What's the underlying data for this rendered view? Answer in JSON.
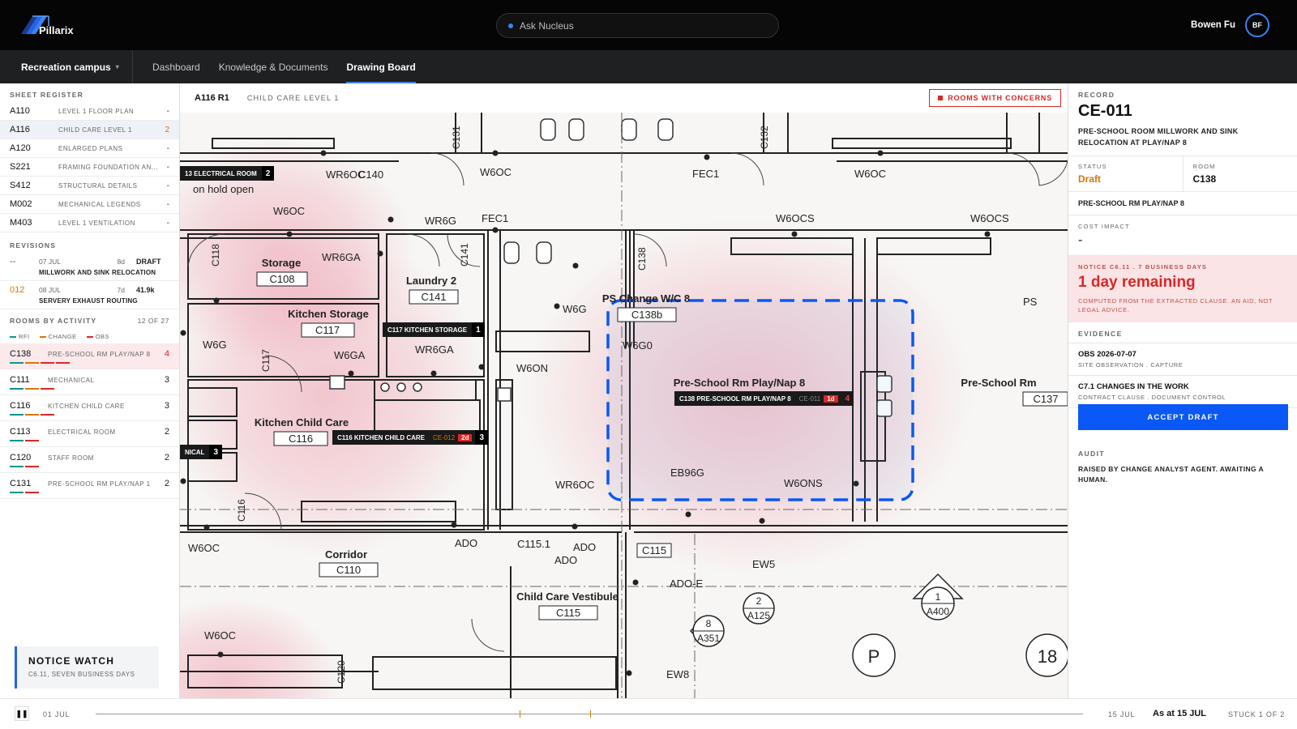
{
  "app": {
    "brand": "Pillarix",
    "search_placeholder": "Ask Nucleus",
    "user_name": "Bowen Fu",
    "user_initials": "BF"
  },
  "nav": {
    "campus": "Recreation campus",
    "tabs": [
      {
        "label": "Dashboard"
      },
      {
        "label": "Knowledge & Documents"
      },
      {
        "label": "Drawing Board"
      }
    ],
    "active_tab": "Drawing Board"
  },
  "sheet_register": {
    "title": "SHEET REGISTER",
    "items": [
      {
        "id": "A110",
        "name": "LEVEL 1 FLOOR PLAN",
        "count": "-"
      },
      {
        "id": "A116",
        "name": "CHILD CARE LEVEL 1",
        "count": "2",
        "active": true
      },
      {
        "id": "A120",
        "name": "ENLARGED PLANS",
        "count": "-"
      },
      {
        "id": "S221",
        "name": "FRAMING FOUNDATION AN...",
        "count": "-"
      },
      {
        "id": "S412",
        "name": "STRUCTURAL DETAILS",
        "count": "-"
      },
      {
        "id": "M002",
        "name": "MECHANICAL LEGENDS",
        "count": "-"
      },
      {
        "id": "M403",
        "name": "LEVEL 1 VENTILATION",
        "count": "-"
      }
    ]
  },
  "revisions": {
    "title": "REVISIONS",
    "items": [
      {
        "id": "--",
        "date": "07 JUL",
        "age": "8d",
        "tag": "DRAFT",
        "desc": "MILLWORK AND SINK RELOCATION"
      },
      {
        "id": "012",
        "date": "08 JUL",
        "age": "7d",
        "tag": "41.9k",
        "desc": "SERVERY EXHAUST ROUTING"
      }
    ]
  },
  "rooms": {
    "title": "ROOMS BY ACTIVITY",
    "count_label": "12 OF 27",
    "legend": [
      {
        "label": "RFI",
        "color": "#0d9488"
      },
      {
        "label": "CHANGE",
        "color": "#d97706"
      },
      {
        "label": "OBS",
        "color": "#dc2626"
      }
    ],
    "items": [
      {
        "id": "C138",
        "name": "PRE-SCHOOL RM PLAY/NAP 8",
        "count": "4",
        "bars": [
          "#0d9488",
          "#d97706",
          "#dc2626",
          "#dc2626"
        ]
      },
      {
        "id": "C111",
        "name": "MECHANICAL",
        "count": "3",
        "bars": [
          "#0d9488",
          "#d97706",
          "#dc2626"
        ]
      },
      {
        "id": "C116",
        "name": "KITCHEN CHILD CARE",
        "count": "3",
        "bars": [
          "#0d9488",
          "#d97706",
          "#dc2626"
        ]
      },
      {
        "id": "C113",
        "name": "ELECTRICAL ROOM",
        "count": "2",
        "bars": [
          "#0d9488",
          "#dc2626"
        ]
      },
      {
        "id": "C120",
        "name": "STAFF ROOM",
        "count": "2",
        "bars": [
          "#0d9488",
          "#dc2626"
        ]
      },
      {
        "id": "C131",
        "name": "PRE-SCHOOL RM PLAY/NAP 1",
        "count": "2",
        "bars": [
          "#0d9488",
          "#dc2626"
        ]
      }
    ]
  },
  "notice_watch": {
    "title": "NOTICE WATCH",
    "subtitle": "C6.11, SEVEN BUSINESS DAYS"
  },
  "drawing": {
    "sheet_id": "A116 R1",
    "sheet_name": "CHILD CARE LEVEL 1",
    "concerns_label": "ROOMS WITH CONCERNS",
    "rooms": [
      {
        "name": "Storage",
        "code": "C108"
      },
      {
        "name": "Laundry 2",
        "code": "C141"
      },
      {
        "name": "Kitchen Storage",
        "code": "C117"
      },
      {
        "name": "Kitchen Child Care",
        "code": "C116"
      },
      {
        "name": "Corridor",
        "code": "C110"
      },
      {
        "name": "Child Care Vestibule",
        "code": "C115"
      },
      {
        "name": "Pre-School Rm Play/Nap 8",
        "code": ""
      },
      {
        "name": "Pre-School Rm",
        "code": "C137"
      },
      {
        "name": "PS Change W/C 8",
        "code": "C138b"
      }
    ],
    "annotations": [
      "on hold open",
      "W6OC",
      "WR6OC",
      "C140",
      "W6G",
      "WR6G",
      "FEC1",
      "W6OCS",
      "WR6GA",
      "W6GA",
      "W6ON",
      "W6G0",
      "WR6OC",
      "EB96G",
      "W6ONS",
      "ADO",
      "C115.1",
      "C115",
      "EW5",
      "ADO-E",
      "EW8",
      "C118",
      "C141",
      "C138",
      "C131",
      "C132",
      "C117",
      "C116",
      "C120",
      "PS"
    ],
    "details": [
      {
        "num": "1",
        "sheet": "A400"
      },
      {
        "num": "2",
        "sheet": "A125"
      },
      {
        "num": "8",
        "sheet": "A351"
      }
    ],
    "markers": [
      "P",
      "18"
    ],
    "tags": [
      {
        "label": "13 ELECTRICAL ROOM",
        "num": "2"
      },
      {
        "label": "C117 KITCHEN STORAGE",
        "num": "1"
      },
      {
        "label": "C138 PRE-SCHOOL RM PLAY/NAP 8",
        "code": "CE-011",
        "due": "1d",
        "num": "4"
      },
      {
        "label": "C116 KITCHEN CHILD CARE",
        "code": "CE-012",
        "due": "2d",
        "num": "3"
      },
      {
        "label": "NICAL",
        "num": "3"
      }
    ]
  },
  "record": {
    "label": "RECORD",
    "id": "CE-011",
    "title": "PRE-SCHOOL ROOM MILLWORK AND SINK RELOCATION AT PLAY/NAP 8",
    "status_label": "STATUS",
    "status": "Draft",
    "room_label": "ROOM",
    "room": "C138",
    "location": "PRE-SCHOOL RM PLAY/NAP 8",
    "cost_label": "COST IMPACT",
    "cost": "-",
    "notice_label": "NOTICE C6.11 . 7 BUSINESS DAYS",
    "remaining": "1 day remaining",
    "computed_note": "COMPUTED FROM THE EXTRACTED CLAUSE. AN AID, NOT LEGAL ADVICE.",
    "evidence_label": "EVIDENCE",
    "evidence": [
      {
        "title": "OBS 2026-07-07",
        "sub": "SITE OBSERVATION . CAPTURE"
      },
      {
        "title": "C7.1 CHANGES IN THE WORK",
        "sub": "CONTRACT CLAUSE . DOCUMENT CONTROL"
      }
    ],
    "accept_label": "ACCEPT DRAFT",
    "audit_label": "AUDIT",
    "audit_text": "RAISED BY CHANGE ANALYST AGENT. AWAITING A HUMAN."
  },
  "timeline": {
    "start": "01 JUL",
    "end": "15 JUL",
    "as_at": "As at 15 JUL",
    "stuck": "STUCK 1 OF 2",
    "paused": true
  },
  "colors": {
    "accent": "#0a58f5",
    "danger": "#dc2626",
    "warning": "#d97706",
    "rfi": "#0d9488"
  }
}
